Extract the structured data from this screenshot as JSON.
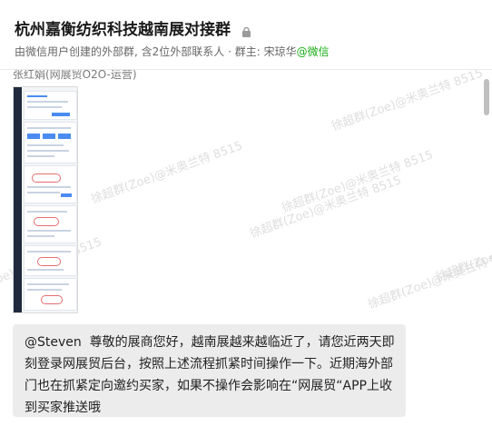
{
  "header": {
    "title": "杭州嘉衡纺织科技越南展对接群",
    "subtitle_prefix": "由微信用户创建的外部群, 含2位外部联系人 · 群主: 宋琼华",
    "subtitle_tag": "@微信",
    "lock_icon": "lock-icon"
  },
  "chat": {
    "watermark_text": "徐超群(Zoe)@米奥兰特 8515",
    "messages": [
      {
        "sender": "张红娟(网展贸O2O-运营)",
        "type": "image",
        "image_description": "long-screenshot-thumbnail"
      },
      {
        "type": "text",
        "text": "@Steven  尊敬的展商您好，越南展越来越临近了，请您近两天即刻登录网展贸后台，按照上述流程抓紧时间操作一下。近期海外部门也在抓紧定向邀约买家，如果不操作会影响在“网展贸“APP上收到买家推送哦"
      }
    ]
  }
}
